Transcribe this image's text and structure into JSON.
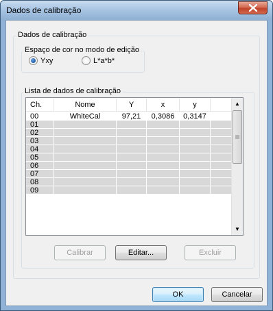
{
  "window": {
    "title": "Dados de calibração"
  },
  "group_main": {
    "label": "Dados de calibração"
  },
  "group_colorspace": {
    "label": "Espaço de cor no modo de edição",
    "options": [
      {
        "label": "Yxy",
        "checked": true
      },
      {
        "label": "L*a*b*",
        "checked": false
      }
    ]
  },
  "group_list": {
    "label": "Lista de dados de calibração"
  },
  "table": {
    "columns": [
      "Ch.",
      "Nome",
      "Y",
      "x",
      "y"
    ],
    "rows": [
      {
        "ch": "00",
        "nome": "WhiteCal",
        "Y": "97,21",
        "x": "0,3086",
        "y": "0,3147"
      },
      {
        "ch": "01",
        "nome": "",
        "Y": "",
        "x": "",
        "y": ""
      },
      {
        "ch": "02",
        "nome": "",
        "Y": "",
        "x": "",
        "y": ""
      },
      {
        "ch": "03",
        "nome": "",
        "Y": "",
        "x": "",
        "y": ""
      },
      {
        "ch": "04",
        "nome": "",
        "Y": "",
        "x": "",
        "y": ""
      },
      {
        "ch": "05",
        "nome": "",
        "Y": "",
        "x": "",
        "y": ""
      },
      {
        "ch": "06",
        "nome": "",
        "Y": "",
        "x": "",
        "y": ""
      },
      {
        "ch": "07",
        "nome": "",
        "Y": "",
        "x": "",
        "y": ""
      },
      {
        "ch": "08",
        "nome": "",
        "Y": "",
        "x": "",
        "y": ""
      },
      {
        "ch": "09",
        "nome": "",
        "Y": "",
        "x": "",
        "y": ""
      }
    ]
  },
  "buttons": {
    "calibrar": "Calibrar",
    "editar": "Editar...",
    "excluir": "Excluir",
    "ok": "OK",
    "cancelar": "Cancelar"
  }
}
